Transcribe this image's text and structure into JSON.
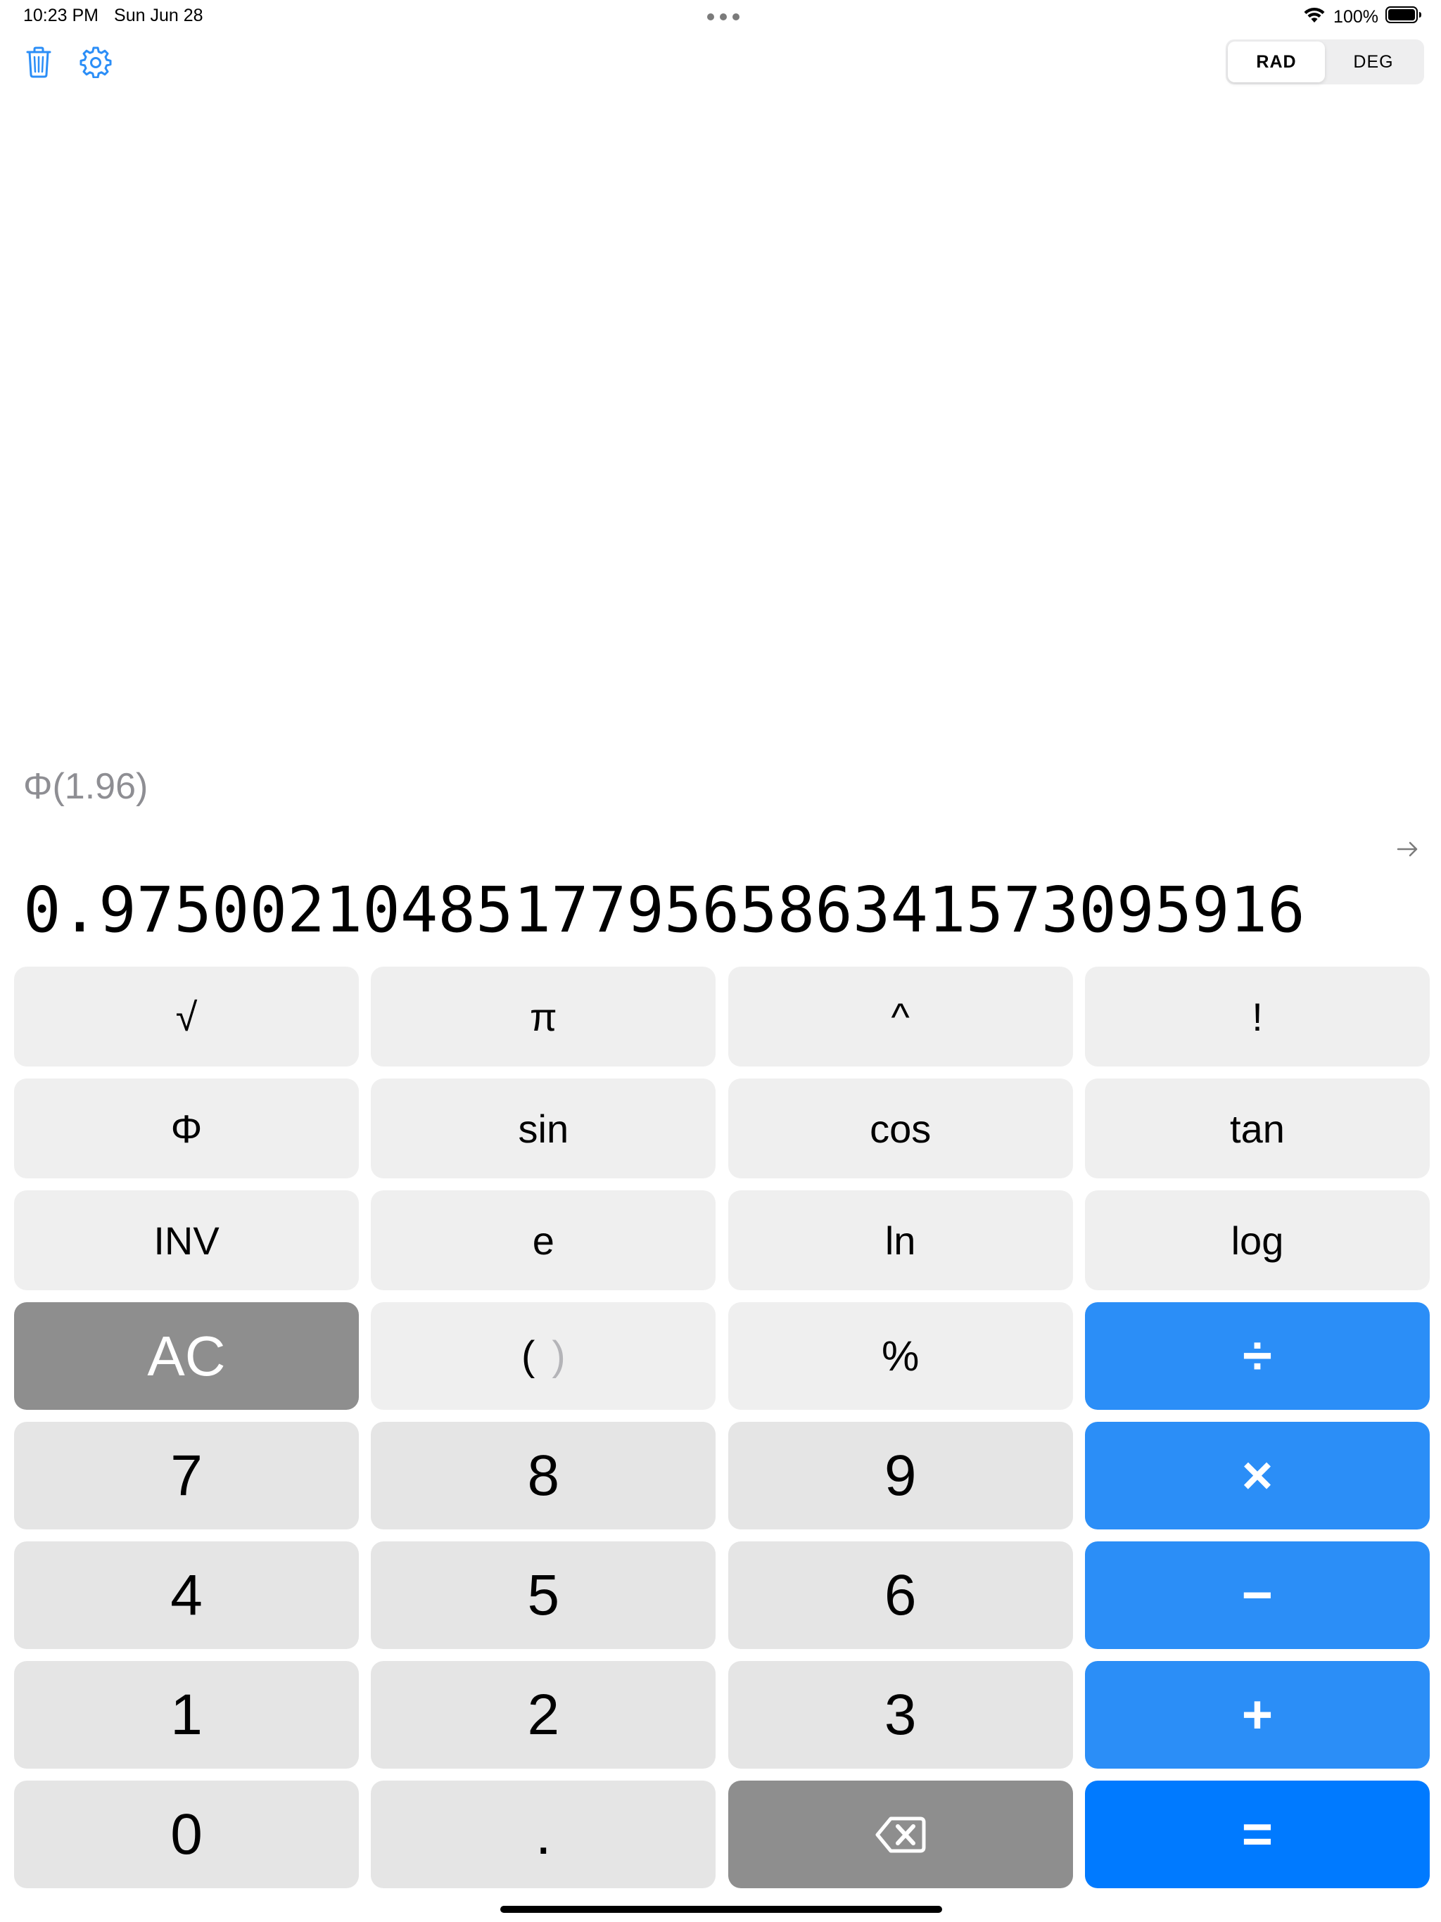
{
  "status_bar": {
    "time": "10:23 PM",
    "date": "Sun Jun 28",
    "battery": "100%"
  },
  "toolbar": {
    "trash_icon": "trash-icon",
    "settings_icon": "gear-icon",
    "accent_color": "#2b8ef7"
  },
  "angle_mode": {
    "options": [
      "RAD",
      "DEG"
    ],
    "selected": "RAD"
  },
  "display": {
    "expression": "Φ(1.96)",
    "result": "0.97500210485177956586341573095916"
  },
  "keypad": {
    "sci_rows": [
      [
        "√",
        "π",
        "^",
        "!"
      ],
      [
        "Φ",
        "sin",
        "cos",
        "tan"
      ],
      [
        "INV",
        "e",
        "ln",
        "log"
      ]
    ],
    "row_clear": {
      "clear": "AC",
      "paren_open": "(",
      "paren_close": ")",
      "percent": "%",
      "divide": "÷"
    },
    "digit_rows": [
      {
        "digits": [
          "7",
          "8",
          "9"
        ],
        "op": "×"
      },
      {
        "digits": [
          "4",
          "5",
          "6"
        ],
        "op": "−"
      },
      {
        "digits": [
          "1",
          "2",
          "3"
        ],
        "op": "+"
      }
    ],
    "bottom_row": {
      "zero": "0",
      "decimal": ".",
      "backspace_icon": "backspace-icon",
      "equals": "="
    }
  },
  "colors": {
    "operator_blue": "#2b8ef7",
    "equals_blue": "#007aff",
    "dark_gray": "#8e8e8e",
    "light_key": "#efefef",
    "digit_key": "#e5e5e5"
  }
}
